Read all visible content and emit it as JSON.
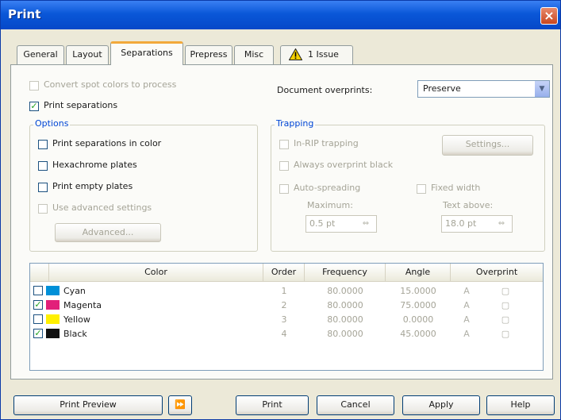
{
  "window": {
    "title": "Print",
    "close_glyph": "×"
  },
  "tabs": [
    {
      "label": "General"
    },
    {
      "label": "Layout"
    },
    {
      "label": "Separations"
    },
    {
      "label": "Prepress"
    },
    {
      "label": "Misc"
    },
    {
      "label": "1 Issue"
    }
  ],
  "separations": {
    "convert_spot": "Convert spot colors to process",
    "print_separations": "Print separations",
    "document_overprints_label": "Document overprints:",
    "document_overprints_value": "Preserve",
    "options": {
      "legend": "Options",
      "print_in_color": "Print separations in color",
      "hexachrome": "Hexachrome plates",
      "print_empty": "Print empty plates",
      "use_advanced": "Use advanced settings",
      "advanced_button": "Advanced..."
    },
    "trapping": {
      "legend": "Trapping",
      "in_rip": "In-RIP trapping",
      "settings_button": "Settings...",
      "always_overprint_black": "Always overprint black",
      "auto_spreading": "Auto-spreading",
      "fixed_width": "Fixed width",
      "maximum_label": "Maximum:",
      "maximum_value": "0.5 pt",
      "text_above_label": "Text above:",
      "text_above_value": "18.0 pt"
    },
    "table": {
      "headers": [
        "Color",
        "Order",
        "Frequency",
        "Angle",
        "Overprint"
      ],
      "rows": [
        {
          "name": "Cyan",
          "swatch": "#0090d8",
          "checked": false,
          "order": "1",
          "frequency": "80.0000",
          "angle": "15.0000"
        },
        {
          "name": "Magenta",
          "swatch": "#e2207a",
          "checked": true,
          "order": "2",
          "frequency": "80.0000",
          "angle": "75.0000"
        },
        {
          "name": "Yellow",
          "swatch": "#fff000",
          "checked": false,
          "order": "3",
          "frequency": "80.0000",
          "angle": "0.0000"
        },
        {
          "name": "Black",
          "swatch": "#111111",
          "checked": true,
          "order": "4",
          "frequency": "80.0000",
          "angle": "45.0000"
        }
      ]
    }
  },
  "buttons": {
    "print_preview": "Print Preview",
    "expand": "⏩",
    "print": "Print",
    "cancel": "Cancel",
    "apply": "Apply",
    "help": "Help"
  },
  "colors": {
    "titlebar": "#0a57d8",
    "tab_highlight": "#f2a93b",
    "legend": "#0046d5"
  }
}
